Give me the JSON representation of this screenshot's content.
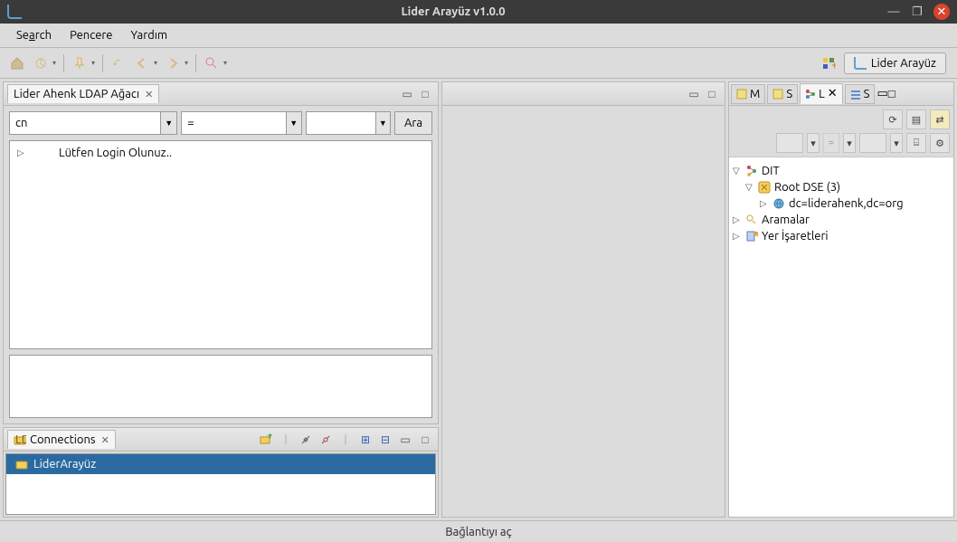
{
  "window": {
    "title": "Lider Arayüz v1.0.0"
  },
  "menus": {
    "search": "Search",
    "pencere": "Pencere",
    "yardim": "Yardım"
  },
  "perspective": {
    "label": "Lider Arayüz"
  },
  "ldap_tree": {
    "title": "Lider Ahenk LDAP Ağacı",
    "search_field": "cn",
    "operator": "=",
    "search_value": "",
    "search_btn": "Ara",
    "login_msg": "Lütfen Login Olunuz.."
  },
  "connections": {
    "title": "Connections",
    "items": [
      "LiderArayüz"
    ]
  },
  "right_tabs": {
    "m": "M",
    "s1": "S",
    "l": "L",
    "s2": "S"
  },
  "ldap_browser": {
    "dit": "DIT",
    "root": "Root DSE (3)",
    "dc": "dc=liderahenk,dc=org",
    "searches": "Aramalar",
    "bookmarks": "Yer İşaretleri"
  },
  "status": "Bağlantıyı aç"
}
